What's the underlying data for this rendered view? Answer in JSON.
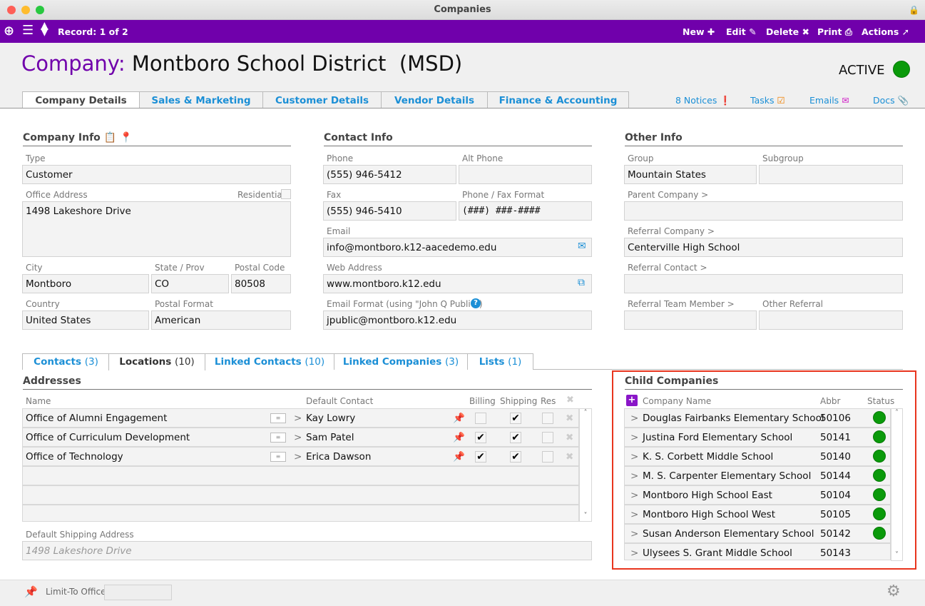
{
  "window": {
    "title": "Companies"
  },
  "toolbar": {
    "record": "Record: 1 of 2",
    "new": "New",
    "edit": "Edit",
    "delete": "Delete",
    "print": "Print",
    "actions": "Actions"
  },
  "header": {
    "label": "Company:",
    "name": "Montboro School District  (MSD)",
    "status": "ACTIVE",
    "status_color": "#0a9a0a",
    "accent": "#7000ab"
  },
  "tabs": [
    "Company Details",
    "Sales & Marketing",
    "Customer Details",
    "Vendor Details",
    "Finance & Accounting"
  ],
  "links": {
    "notices": "8 Notices",
    "tasks": "Tasks",
    "emails": "Emails",
    "docs": "Docs"
  },
  "company_info": {
    "title": "Company Info",
    "type_label": "Type",
    "type": "Customer",
    "address_label": "Office Address",
    "residential_label": "Residential",
    "address": "1498 Lakeshore Drive",
    "city_label": "City",
    "city": "Montboro",
    "state_label": "State / Prov",
    "state": "CO",
    "postal_label": "Postal Code",
    "postal": "80508",
    "country_label": "Country",
    "country": "United States",
    "postal_format_label": "Postal Format",
    "postal_format": "American"
  },
  "contact_info": {
    "title": "Contact Info",
    "phone_label": "Phone",
    "phone": "(555) 946-5412",
    "alt_phone_label": "Alt Phone",
    "alt_phone": "",
    "fax_label": "Fax",
    "fax": "(555) 946-5410",
    "format_label": "Phone / Fax Format",
    "format": "(###) ###-####",
    "email_label": "Email",
    "email": "info@montboro.k12-aacedemo.edu",
    "web_label": "Web Address",
    "web": "www.montboro.k12.edu",
    "email_format_label": "Email Format (using \"John Q Public\")",
    "email_format": "jpublic@montboro.k12.edu"
  },
  "other_info": {
    "title": "Other Info",
    "group_label": "Group",
    "group": "Mountain States",
    "subgroup_label": "Subgroup",
    "subgroup": "",
    "parent_label": "Parent Company >",
    "parent": "",
    "ref_company_label": "Referral Company >",
    "ref_company": "Centerville High School",
    "ref_contact_label": "Referral Contact >",
    "ref_contact": "",
    "ref_team_label": "Referral Team Member >",
    "ref_team": "",
    "other_ref_label": "Other Referral",
    "other_ref": ""
  },
  "subtabs": [
    {
      "label": "Contacts",
      "count": "(3)"
    },
    {
      "label": "Locations",
      "count": "(10)"
    },
    {
      "label": "Linked Contacts",
      "count": "(10)"
    },
    {
      "label": "Linked Companies",
      "count": "(3)"
    },
    {
      "label": "Lists",
      "count": "(1)"
    }
  ],
  "addresses": {
    "title": "Addresses",
    "cols": {
      "name": "Name",
      "contact": "Default Contact",
      "billing": "Billing",
      "shipping": "Shipping",
      "res": "Res"
    },
    "rows": [
      {
        "name": "Office of Alumni Engagement",
        "contact": "Kay Lowry",
        "billing": false,
        "shipping": true,
        "res": false
      },
      {
        "name": "Office of Curriculum Development",
        "contact": "Sam Patel",
        "billing": true,
        "shipping": true,
        "res": false
      },
      {
        "name": "Office of Technology",
        "contact": "Erica Dawson",
        "billing": true,
        "shipping": true,
        "res": false
      }
    ],
    "shipping_label": "Default Shipping Address",
    "shipping_placeholder": "1498 Lakeshore Drive"
  },
  "child_companies": {
    "title": "Child Companies",
    "cols": {
      "name": "Company Name",
      "abbr": "Abbr",
      "status": "Status"
    },
    "rows": [
      {
        "name": "Douglas Fairbanks Elementary School",
        "abbr": "50106",
        "active": true
      },
      {
        "name": "Justina Ford Elementary School",
        "abbr": "50141",
        "active": true
      },
      {
        "name": "K. S. Corbett Middle School",
        "abbr": "50140",
        "active": true
      },
      {
        "name": "M. S. Carpenter Elementary School",
        "abbr": "50144",
        "active": true
      },
      {
        "name": "Montboro High School East",
        "abbr": "50104",
        "active": true
      },
      {
        "name": "Montboro High School West",
        "abbr": "50105",
        "active": true
      },
      {
        "name": "Susan Anderson Elementary School",
        "abbr": "50142",
        "active": true
      },
      {
        "name": "Ulysees S. Grant Middle School",
        "abbr": "50143",
        "active": false
      }
    ]
  },
  "footer": {
    "limit_label": "Limit-To Office",
    "limit_value": ""
  }
}
